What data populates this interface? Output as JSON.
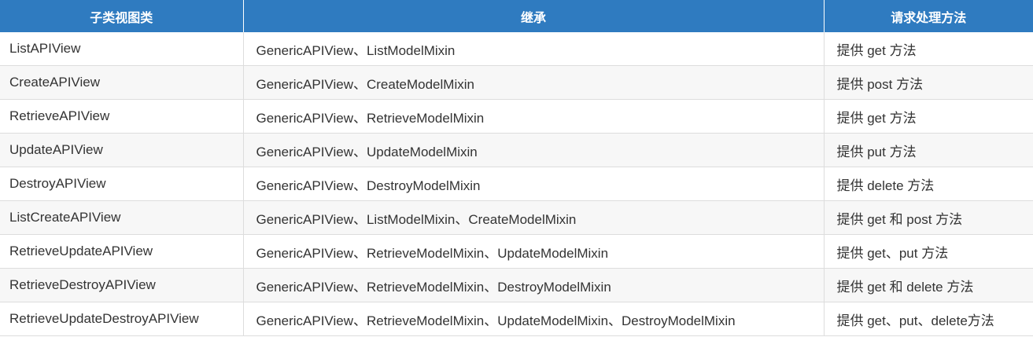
{
  "table": {
    "headers": [
      "子类视图类",
      "继承",
      "请求处理方法"
    ],
    "rows": [
      [
        "ListAPIView",
        "GenericAPIView、ListModelMixin",
        "提供 get 方法"
      ],
      [
        "CreateAPIView",
        "GenericAPIView、CreateModelMixin",
        "提供 post 方法"
      ],
      [
        "RetrieveAPIView",
        "GenericAPIView、RetrieveModelMixin",
        "提供 get 方法"
      ],
      [
        "UpdateAPIView",
        "GenericAPIView、UpdateModelMixin",
        "提供 put 方法"
      ],
      [
        "DestroyAPIView",
        "GenericAPIView、DestroyModelMixin",
        "提供 delete 方法"
      ],
      [
        "ListCreateAPIView",
        "GenericAPIView、ListModelMixin、CreateModelMixin",
        "提供 get 和 post 方法"
      ],
      [
        "RetrieveUpdateAPIView",
        "GenericAPIView、RetrieveModelMixin、UpdateModelMixin",
        "提供 get、put 方法"
      ],
      [
        "RetrieveDestroyAPIView",
        "GenericAPIView、RetrieveModelMixin、DestroyModelMixin",
        "提供 get 和 delete 方法"
      ],
      [
        "RetrieveUpdateDestroyAPIView",
        "GenericAPIView、RetrieveModelMixin、UpdateModelMixin、DestroyModelMixin",
        "提供 get、put、delete方法"
      ]
    ]
  },
  "colors": {
    "header_bg": "#2f7bc0",
    "header_text": "#ffffff",
    "row_alt_bg": "#f7f7f7",
    "border": "#dddddd",
    "text": "#333333"
  }
}
